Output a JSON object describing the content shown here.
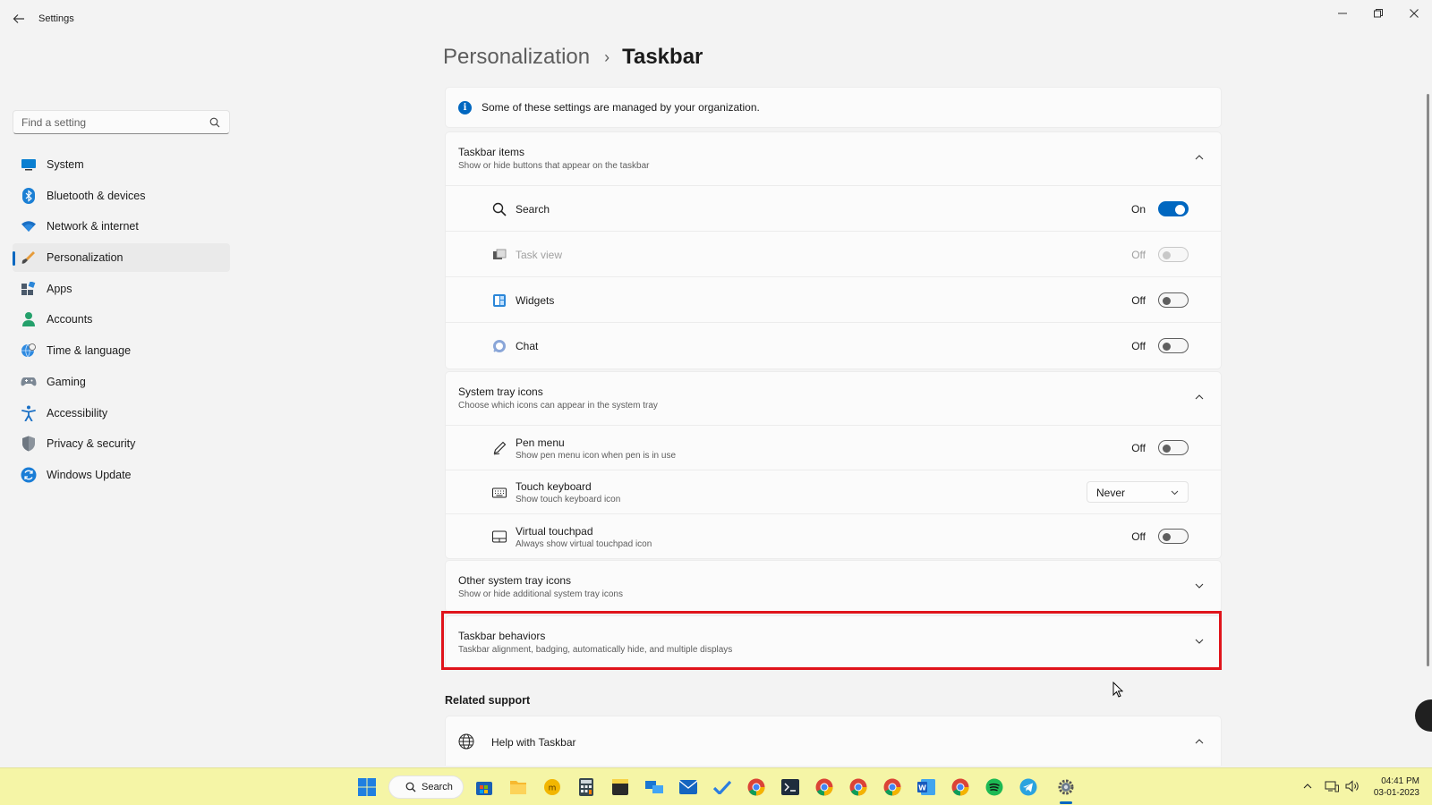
{
  "window": {
    "app_title": "Settings"
  },
  "sidebar": {
    "search_placeholder": "Find a setting",
    "items": [
      {
        "label": "System",
        "icon": "monitor-icon",
        "active": false
      },
      {
        "label": "Bluetooth & devices",
        "icon": "bluetooth-icon",
        "active": false
      },
      {
        "label": "Network & internet",
        "icon": "wifi-icon",
        "active": false
      },
      {
        "label": "Personalization",
        "icon": "brush-icon",
        "active": true
      },
      {
        "label": "Apps",
        "icon": "apps-icon",
        "active": false
      },
      {
        "label": "Accounts",
        "icon": "person-icon",
        "active": false
      },
      {
        "label": "Time & language",
        "icon": "globe-clock-icon",
        "active": false
      },
      {
        "label": "Gaming",
        "icon": "gamepad-icon",
        "active": false
      },
      {
        "label": "Accessibility",
        "icon": "accessibility-icon",
        "active": false
      },
      {
        "label": "Privacy & security",
        "icon": "shield-icon",
        "active": false
      },
      {
        "label": "Windows Update",
        "icon": "update-icon",
        "active": false
      }
    ]
  },
  "breadcrumb": {
    "parent": "Personalization",
    "separator": "›",
    "current": "Taskbar"
  },
  "info_bar": {
    "icon": "i",
    "text": "Some of these settings are managed by your organization."
  },
  "taskbar_items": {
    "title": "Taskbar items",
    "subtitle": "Show or hide buttons that appear on the taskbar",
    "rows": [
      {
        "label": "Search",
        "state": "On",
        "enabled": true
      },
      {
        "label": "Task view",
        "state": "Off",
        "enabled": false
      },
      {
        "label": "Widgets",
        "state": "Off",
        "enabled": true
      },
      {
        "label": "Chat",
        "state": "Off",
        "enabled": true
      }
    ]
  },
  "system_tray": {
    "title": "System tray icons",
    "subtitle": "Choose which icons can appear in the system tray",
    "pen_menu": {
      "label": "Pen menu",
      "sub": "Show pen menu icon when pen is in use",
      "state": "Off"
    },
    "touch_keyboard": {
      "label": "Touch keyboard",
      "sub": "Show touch keyboard icon",
      "value": "Never"
    },
    "virtual_touchpad": {
      "label": "Virtual touchpad",
      "sub": "Always show virtual touchpad icon",
      "state": "Off"
    }
  },
  "other_tray": {
    "title": "Other system tray icons",
    "subtitle": "Show or hide additional system tray icons"
  },
  "behaviors": {
    "title": "Taskbar behaviors",
    "subtitle": "Taskbar alignment, badging, automatically hide, and multiple displays"
  },
  "related": {
    "title": "Related support",
    "help_label": "Help with Taskbar"
  },
  "os_taskbar": {
    "search_label": "Search",
    "time": "04:41 PM",
    "date": "03-01-2023",
    "background": "#f5f5a6"
  },
  "colors": {
    "accent": "#0067c0",
    "highlight": "#e0141b"
  }
}
